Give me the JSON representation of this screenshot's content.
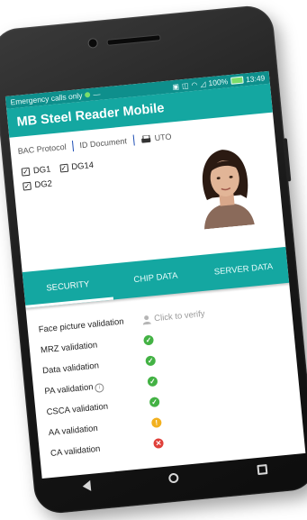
{
  "status_bar": {
    "left_text": "Emergency calls only",
    "battery": "100%",
    "time": "13:49"
  },
  "app": {
    "title": "MB Steel Reader Mobile"
  },
  "top_tabs": [
    {
      "label": "BAC Protocol"
    },
    {
      "label": "ID Document"
    },
    {
      "label": "UTO",
      "icon": "card-reader-icon"
    }
  ],
  "datagroups": [
    {
      "label": "DG1",
      "checked": true
    },
    {
      "label": "DG14",
      "checked": true
    },
    {
      "label": "DG2",
      "checked": true
    }
  ],
  "photo": {
    "icon": "face-photo"
  },
  "main_tabs": [
    {
      "label": "SECURITY",
      "active": true
    },
    {
      "label": "CHIP DATA",
      "active": false
    },
    {
      "label": "SERVER DATA",
      "active": false
    }
  ],
  "validations": [
    {
      "label": "Face picture validation",
      "status": "verify",
      "action_label": "Click to verify"
    },
    {
      "label": "MRZ validation",
      "status": "ok"
    },
    {
      "label": "Data validation",
      "status": "ok"
    },
    {
      "label": "PA validation",
      "status": "ok",
      "has_info": true
    },
    {
      "label": "CSCA validation",
      "status": "ok"
    },
    {
      "label": "AA validation",
      "status": "warning"
    },
    {
      "label": "CA validation",
      "status": "error"
    }
  ],
  "colors": {
    "accent": "#14a7a1",
    "ok": "#43b244",
    "warning": "#f2b01e",
    "error": "#e0403a"
  }
}
